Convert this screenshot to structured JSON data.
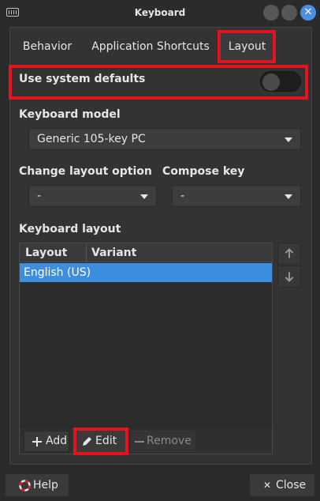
{
  "window": {
    "title": "Keyboard"
  },
  "tabs": [
    {
      "label": "Behavior"
    },
    {
      "label": "Application Shortcuts"
    },
    {
      "label": "Layout",
      "active": true
    }
  ],
  "defaults": {
    "label": "Use system defaults",
    "enabled": false
  },
  "keyboard_model": {
    "label": "Keyboard model",
    "value": "Generic 105-key PC"
  },
  "change_layout": {
    "label": "Change layout option",
    "value": "-"
  },
  "compose_key": {
    "label": "Compose key",
    "value": "-"
  },
  "keyboard_layout": {
    "label": "Keyboard layout",
    "columns": [
      "Layout",
      "Variant"
    ],
    "rows": [
      {
        "layout": "English (US)",
        "variant": ""
      }
    ]
  },
  "toolbar": {
    "add_label": "Add",
    "edit_label": "Edit",
    "remove_label": "Remove"
  },
  "footer": {
    "help_label": "Help",
    "close_label": "Close"
  },
  "colors": {
    "accent": "#3d8ee0",
    "highlight": "#e3141f",
    "background": "#2a2a2a"
  },
  "icons": [
    "keyboard-icon",
    "minimize-icon",
    "maximize-icon",
    "close-icon",
    "chevron-down-icon",
    "arrow-up-icon",
    "arrow-down-icon",
    "plus-icon",
    "pencil-icon",
    "minus-icon",
    "help-icon",
    "close-x-icon"
  ]
}
